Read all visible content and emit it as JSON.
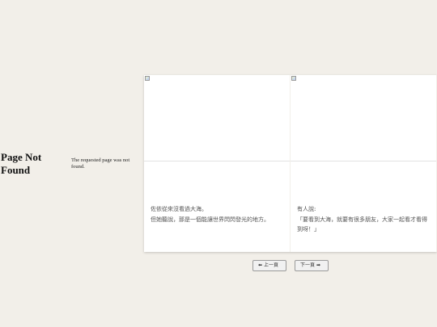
{
  "error": {
    "title": "Page Not Found",
    "message": "The requested page was not found."
  },
  "cards": [
    {
      "image_icon": "broken-image-icon",
      "lines": [
        "佐依從來沒看過大海。",
        "但她聽說，那是一個能讓世界閃閃發光的地方。"
      ]
    },
    {
      "image_icon": "broken-image-icon",
      "lines": [
        "有人說:",
        "「要看到大海，就要有很多朋友，大家一起看才看得到呀！」"
      ]
    }
  ],
  "pagination": {
    "prev_arrow": "⬅",
    "prev_label": "上一頁",
    "next_label": "下一頁",
    "next_arrow": "➡"
  }
}
